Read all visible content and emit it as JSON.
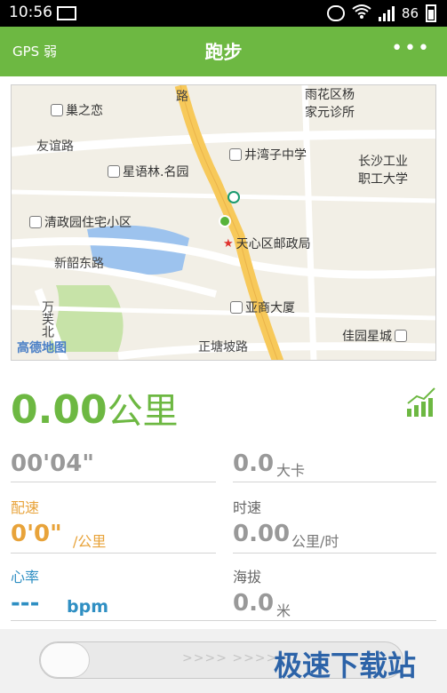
{
  "status_bar": {
    "time": "10:56",
    "battery_level": "86"
  },
  "app_bar": {
    "gps_status": "GPS 弱",
    "title": "跑步",
    "more_label": "•••"
  },
  "map": {
    "labels": {
      "yuhua_family_clinic_line1": "雨花区杨",
      "yuhua_family_clinic_line2": "家元诊所",
      "chaozhilian": "巢之恋",
      "youyi_road": "友谊路",
      "jingwanzi_school": "井湾子中学",
      "changsha_college_line1": "长沙工业",
      "changsha_college_line2": "职工大学",
      "xingyulin": "星语林.名园",
      "qingzhengyuan": "清政园住宅小区",
      "tianxin_post": "天心区邮政局",
      "xinshao_road": "新韶东路",
      "yashang_tower": "亚商大厦",
      "wanfu_north": "万芙北",
      "zhengtangpo_road": "正塘坡路",
      "jiayuan_xingcheng": "佳园星城",
      "road_top": "路",
      "logo": "高德地图"
    },
    "colors": {
      "main_road": "#f7c95a",
      "water": "#9dc3ee",
      "park": "#c7e3a8"
    }
  },
  "stats": {
    "distance_value": "0.00",
    "distance_unit": "公里",
    "duration": "00'04\"",
    "calories_value": "0.0",
    "calories_unit": "大卡",
    "pace_label": "配速",
    "pace_value": "0'0\"",
    "pace_unit": "/公里",
    "speed_label": "时速",
    "speed_value": "0.00",
    "speed_unit": "公里/时",
    "heart_label": "心率",
    "heart_value": "---",
    "heart_unit": "bpm",
    "altitude_label": "海拔",
    "altitude_value": "0.0",
    "altitude_unit": "米",
    "colors": {
      "green": "#6db842",
      "orange": "#e8a33a",
      "blue": "#2f8fc3"
    }
  },
  "footer": {
    "slider_arrows": ">>>> >>>>>",
    "watermark": "极速下载站"
  },
  "icons": {
    "statusbar": [
      "image-icon",
      "mute-icon",
      "wifi-icon",
      "signal-icon",
      "battery-icon"
    ],
    "map": [
      "metro-icon",
      "location-dot-icon",
      "poi-icon",
      "star-icon"
    ],
    "stats": [
      "chart-icon"
    ]
  }
}
